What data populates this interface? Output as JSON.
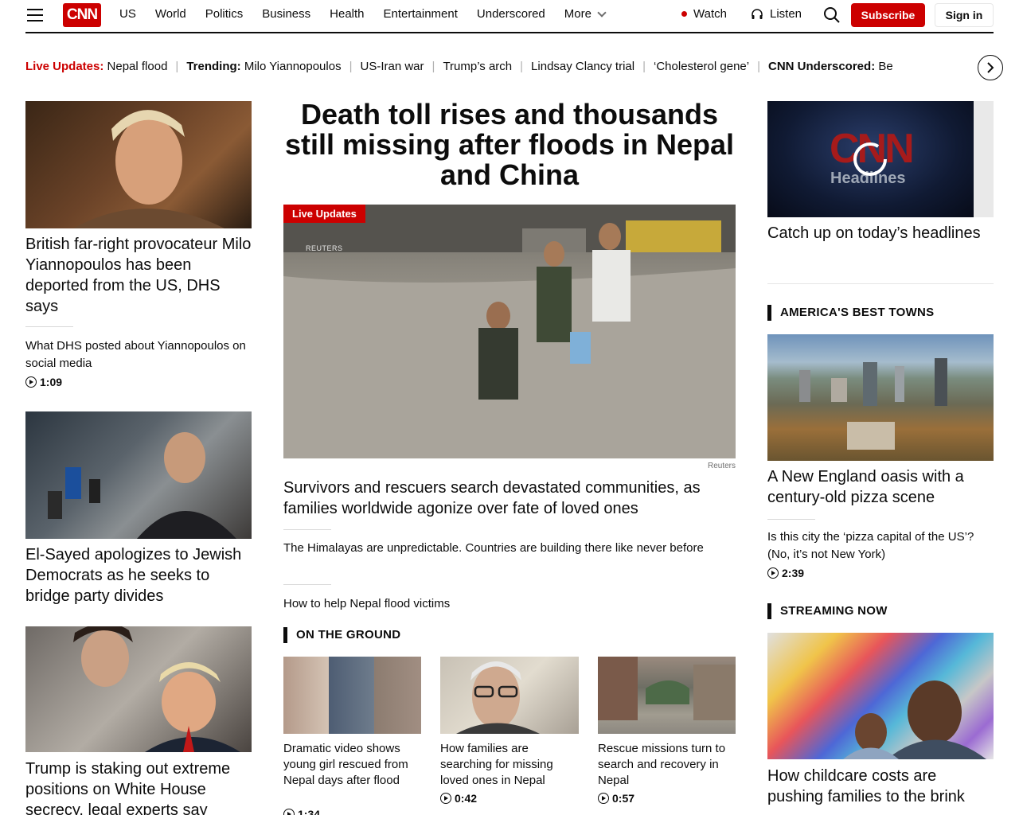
{
  "header": {
    "logo": "CNN",
    "nav": [
      "US",
      "World",
      "Politics",
      "Business",
      "Health",
      "Entertainment",
      "Underscored"
    ],
    "more_label": "More",
    "watch_label": "Watch",
    "listen_label": "Listen",
    "subscribe_label": "Subscribe",
    "signin_label": "Sign in"
  },
  "ticker": {
    "live_label": "Live Updates:",
    "live_text": "Nepal flood",
    "trending_label": "Trending:",
    "trending_text": "Milo Yiannopoulos",
    "items": [
      "US-Iran war",
      "Trump’s arch",
      "Lindsay Clancy trial",
      "‘Cholesterol gene’"
    ],
    "underscored_label": "CNN Underscored:",
    "underscored_text": "Be"
  },
  "left": {
    "story1": {
      "title": "British far-right provocateur Milo Yiannopoulos has been deported from the US, DHS says",
      "sub_link": "What DHS posted about Yiannopoulos on social media",
      "duration": "1:09"
    },
    "story2": {
      "title": "El-Sayed apologizes to Jewish Democrats as he seeks to bridge party divides"
    },
    "story3": {
      "title": "Trump is staking out extreme positions on White House secrecy, legal experts say"
    }
  },
  "center": {
    "headline": "Death toll rises and thousands still missing after floods in Nepal and China",
    "badge": "Live Updates",
    "watermark": "REUTERS",
    "credit": "Reuters",
    "lead_title": "Survivors and rescuers search devastated communities, as families worldwide agonize over fate of loved ones",
    "link1": "The Himalayas are unpredictable. Countries are building there like never before",
    "link2": "How to help Nepal flood victims",
    "section": "ON THE GROUND",
    "cards": [
      {
        "title": "Dramatic video shows young girl rescued from Nepal days after flood",
        "duration": "1:34"
      },
      {
        "title": "How families are searching for missing loved ones in Nepal",
        "duration": "0:42"
      },
      {
        "title": "Rescue missions turn to search and recovery in Nepal",
        "duration": "0:57"
      }
    ]
  },
  "right": {
    "video_logo": "CNN",
    "video_sub": "Headlines",
    "video_title": "Catch up on today’s headlines",
    "section1": "AMERICA'S BEST TOWNS",
    "town_title": "A New England oasis with a century-old pizza scene",
    "town_link": "Is this city the ‘pizza capital of the US’? (No, it’s not New York)",
    "town_duration": "2:39",
    "section2": "STREAMING NOW",
    "stream_title": "How childcare costs are pushing families to the brink"
  }
}
